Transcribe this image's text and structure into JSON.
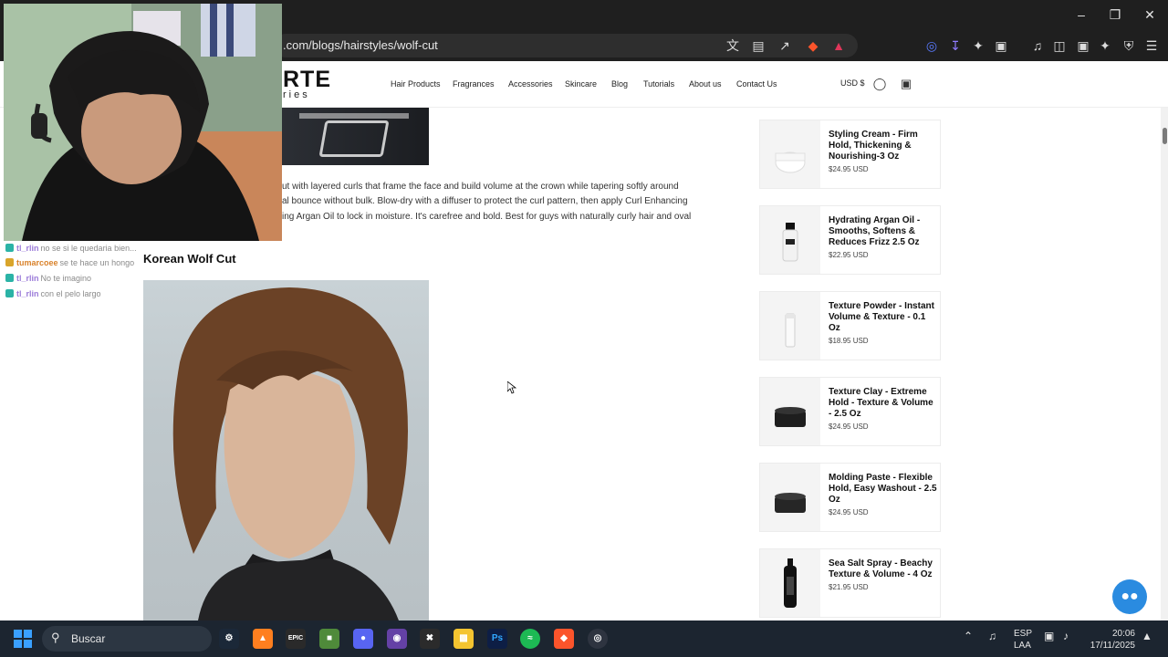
{
  "browser": {
    "url": ".com/blogs/hairstyles/wolf-cut"
  },
  "site": {
    "logo_text": "RTE",
    "logo_sub": "ries",
    "nav": [
      "Hair Products",
      "Fragrances",
      "Accessories",
      "Skincare",
      "Blog",
      "Tutorials",
      "About us",
      "Contact Us"
    ],
    "currency": "USD $"
  },
  "article": {
    "paragraph_lines": [
      "ut with layered curls that frame the face and build volume at the crown while tapering softly around",
      "al bounce without bulk. Blow-dry with a diffuser to protect the curl pattern, then apply Curl Enhancing",
      "ing Argan Oil to lock in moisture. It's carefree and bold. Best for guys with naturally curly hair and oval"
    ],
    "section_heading": "Korean Wolf Cut"
  },
  "products": [
    {
      "name": "Styling Cream - Firm Hold, Thickening & Nourishing-3 Oz",
      "price": "$24.95 USD",
      "kind": "jar-white"
    },
    {
      "name": "Hydrating Argan Oil - Smooths, Softens & Reduces Frizz 2.5 Oz",
      "price": "$22.95 USD",
      "kind": "bottle"
    },
    {
      "name": "Texture Powder - Instant Volume & Texture - 0.1 Oz",
      "price": "$18.95 USD",
      "kind": "powder"
    },
    {
      "name": "Texture Clay - Extreme Hold - Texture & Volume - 2.5 Oz",
      "price": "$24.95 USD",
      "kind": "jar-black"
    },
    {
      "name": "Molding Paste - Flexible Hold, Easy Washout - 2.5 Oz",
      "price": "$24.95 USD",
      "kind": "jar-black"
    },
    {
      "name": "Sea Salt Spray - Beachy Texture & Volume - 4 Oz",
      "price": "$21.95 USD",
      "kind": "spray"
    }
  ],
  "stream_chat": [
    {
      "user": "tl_rlin",
      "text": "no se si le quedaria bien...",
      "badge_color": "#2bb3a6",
      "user_color": "#9b7bd9"
    },
    {
      "user": "tumarcoee",
      "text": "se te hace un hongo",
      "badge_color": "#d9a52b",
      "user_color": "#d9822b"
    },
    {
      "user": "tl_rlin",
      "text": "No te imagino",
      "badge_color": "#2bb3a6",
      "user_color": "#9b7bd9"
    },
    {
      "user": "tl_rlin",
      "text": "con el pelo largo",
      "badge_color": "#2bb3a6",
      "user_color": "#9b7bd9"
    }
  ],
  "taskbar": {
    "search_label": "Buscar",
    "lang_line1": "ESP",
    "lang_line2": "LAA",
    "time": "20:06",
    "date": "17/11/2025"
  },
  "icons": {
    "window": [
      "minimize-icon",
      "restore-icon",
      "close-icon"
    ],
    "address_bar": [
      "translate-icon",
      "reader-icon",
      "share-icon",
      "brave-shields-icon",
      "brave-rewards-icon"
    ],
    "toolbar": [
      "extension-audio-icon",
      "extension-download-icon",
      "extensions-icon",
      "screenshot-icon",
      "media-icon",
      "sidebar-icon",
      "wallet-icon",
      "leo-ai-icon",
      "vpn-icon",
      "menu-icon"
    ],
    "header": [
      "account-icon",
      "cart-icon"
    ]
  }
}
